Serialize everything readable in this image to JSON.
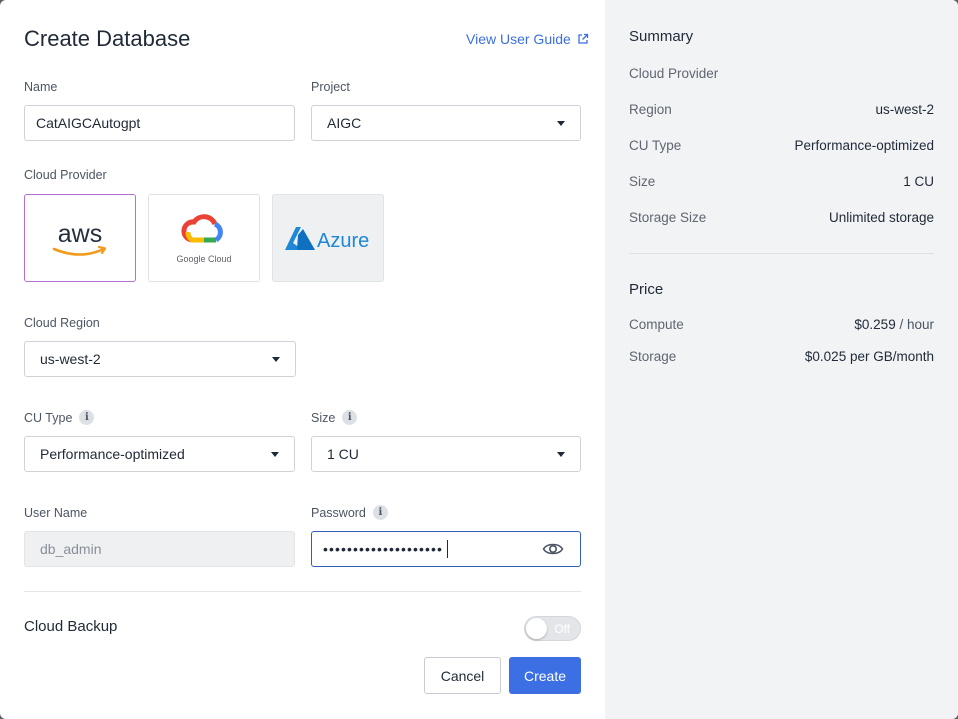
{
  "dialog": {
    "title": "Create Database",
    "guide_link": "View User Guide"
  },
  "form": {
    "name_label": "Name",
    "name_value": "CatAIGCAutogpt",
    "project_label": "Project",
    "project_value": "AIGC",
    "cloud_provider_label": "Cloud Provider",
    "providers": [
      {
        "name": "aws",
        "selected": true
      },
      {
        "name": "Google Cloud",
        "selected": false
      },
      {
        "name": "Azure",
        "selected": false
      }
    ],
    "region_label": "Cloud Region",
    "region_value": "us-west-2",
    "cu_type_label": "CU Type",
    "cu_type_value": "Performance-optimized",
    "size_label": "Size",
    "size_value": "1 CU",
    "username_label": "User Name",
    "username_value": "db_admin",
    "password_label": "Password",
    "password_value": "••••••••••••••••••••",
    "backup_label": "Cloud Backup",
    "backup_toggle": "Off",
    "cancel_label": "Cancel",
    "create_label": "Create"
  },
  "summary": {
    "title": "Summary",
    "rows": [
      {
        "key": "Cloud Provider",
        "value": ""
      },
      {
        "key": "Region",
        "value": "us-west-2"
      },
      {
        "key": "CU Type",
        "value": "Performance-optimized"
      },
      {
        "key": "Size",
        "value": "1 CU"
      },
      {
        "key": "Storage Size",
        "value": "Unlimited storage"
      }
    ]
  },
  "price": {
    "title": "Price",
    "compute_label": "Compute",
    "compute_value": "$0.259",
    "compute_unit": "/ hour",
    "storage_label": "Storage",
    "storage_value": "$0.025 per GB/month"
  },
  "colors": {
    "accent": "#3b6fe3",
    "selected_border": "#b26fd6",
    "summary_bg": "#f2f3f5"
  }
}
